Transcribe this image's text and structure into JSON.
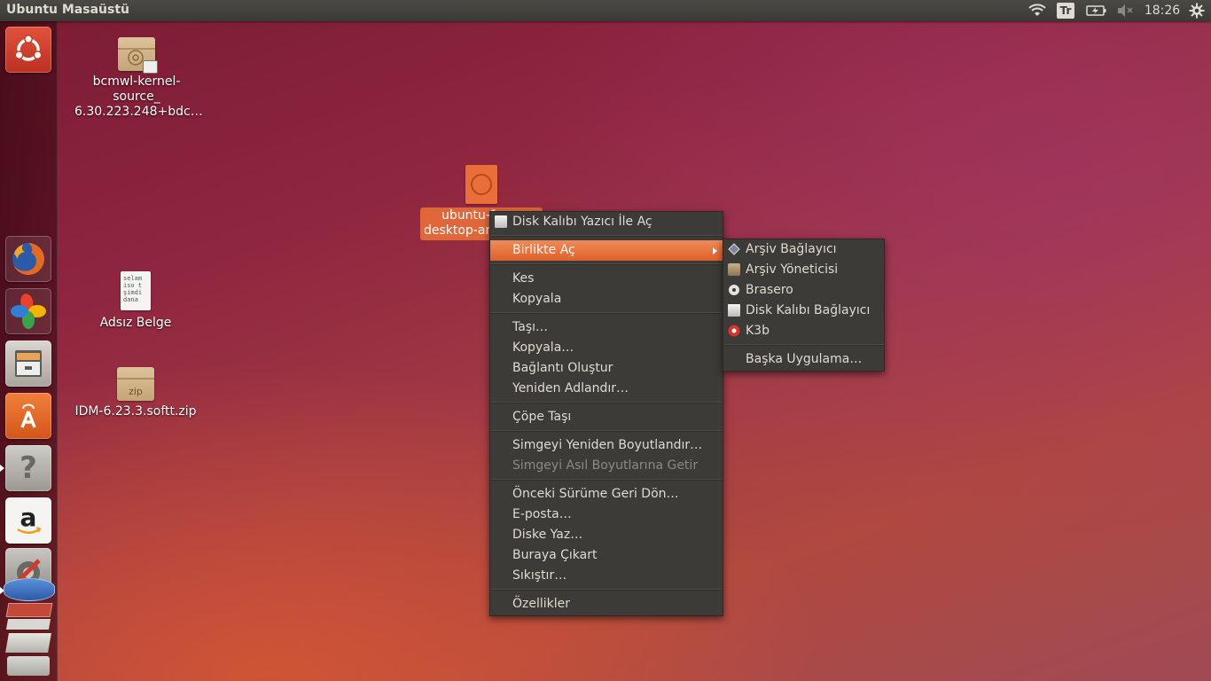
{
  "panel": {
    "title": "Ubuntu Masaüstü",
    "keyboard_layout": "Tr",
    "clock": "18:26",
    "icons": [
      "wifi-icon",
      "battery-icon",
      "volume-muted-icon",
      "gear-icon"
    ]
  },
  "launcher": {
    "items": [
      {
        "name": "dash-home",
        "icon": "ubuntu-logo-icon"
      },
      {
        "name": "firefox",
        "icon": "firefox-icon"
      },
      {
        "name": "crossover",
        "icon": "clover-icon"
      },
      {
        "name": "files",
        "icon": "file-cabinet-icon"
      },
      {
        "name": "software-center",
        "icon": "shopping-bag-icon"
      },
      {
        "name": "help",
        "icon": "question-icon"
      },
      {
        "name": "amazon",
        "icon": "amazon-icon"
      },
      {
        "name": "system-settings",
        "icon": "settings-wrench-icon"
      }
    ]
  },
  "desktop": {
    "icons": [
      {
        "label_lines": [
          "bcmwl-kernel-",
          "source_",
          "6.30.223.248+bdc…"
        ]
      },
      {
        "label_lines": [
          "Adsız Belge"
        ],
        "preview_lines": [
          "selam",
          "iso t",
          "şimdi",
          "dana"
        ]
      },
      {
        "label_lines": [
          "IDM-6.23.3.softt.zip"
        ],
        "badge": "zip"
      },
      {
        "label_lines": [
          "ubuntu-1",
          "desktop-am"
        ]
      }
    ]
  },
  "context_menu": {
    "items": [
      {
        "label": "Disk Kalıbı Yazıcı İle Aç"
      },
      {
        "label": "Birlikte Aç"
      },
      {
        "label": "Kes"
      },
      {
        "label": "Kopyala"
      },
      {
        "label": "Taşı…"
      },
      {
        "label": "Kopyala…"
      },
      {
        "label": "Bağlantı Oluştur"
      },
      {
        "label": "Yeniden Adlandır…"
      },
      {
        "label": "Çöpe Taşı"
      },
      {
        "label": "Simgeyi Yeniden Boyutlandır…"
      },
      {
        "label": "Simgeyi Asıl Boyutlarına Getir"
      },
      {
        "label": "Önceki Sürüme Geri Dön…"
      },
      {
        "label": "E-posta…"
      },
      {
        "label": "Diske Yaz…"
      },
      {
        "label": "Buraya Çıkart"
      },
      {
        "label": "Sıkıştır…"
      },
      {
        "label": "Özellikler"
      }
    ]
  },
  "open_with_submenu": {
    "items": [
      {
        "label": "Arşiv Bağlayıcı"
      },
      {
        "label": "Arşiv Yöneticisi"
      },
      {
        "label": "Brasero"
      },
      {
        "label": "Disk Kalıbı Bağlayıcı"
      },
      {
        "label": "K3b"
      },
      {
        "label": "Başka Uygulama…"
      }
    ]
  },
  "colors": {
    "highlight": "#e0612c",
    "menu_bg": "#3c3b37",
    "panel_bg": "#3b3a36"
  }
}
